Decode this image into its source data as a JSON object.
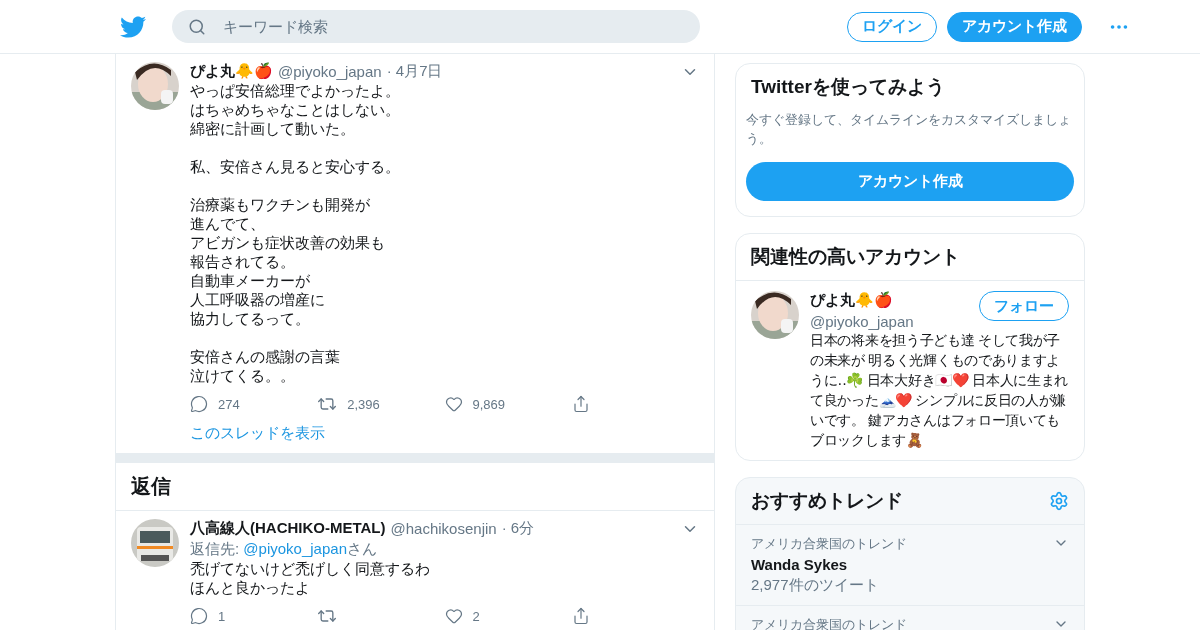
{
  "header": {
    "search": {
      "placeholder": "キーワード検索"
    },
    "login": "ログイン",
    "signup": "アカウント作成"
  },
  "tweet": {
    "name": "ぴよ丸🐥🍎",
    "handle": "@piyoko_japan",
    "time": "· 4月7日",
    "body": [
      [
        "やっぱ安倍総理でよかったよ。",
        "はちゃめちゃなことはしない。",
        "綿密に計画して動いた。"
      ],
      [
        "私、安倍さん見ると安心する。"
      ],
      [
        "治療薬もワクチンも開発が",
        "進んでて、",
        "アビガンも症状改善の効果も",
        "報告されてる。",
        "自動車メーカーが",
        "人工呼吸器の増産に",
        "協力してるって。"
      ],
      [
        "安倍さんの感謝の言葉",
        "泣けてくる。。"
      ]
    ],
    "replies": "274",
    "retweets": "2,396",
    "likes": "9,869",
    "thread_link": "このスレッドを表示"
  },
  "replies_heading": "返信",
  "reply": {
    "name": "八高線人(HACHIKO-METAL)",
    "handle": "@hachikosenjin",
    "time": "· 6分",
    "reply_to": {
      "prefix": "返信先: ",
      "mention": "@piyoko_japan",
      "suffix": "さん"
    },
    "body": [
      [
        "禿げてないけど禿げしく同意するわ",
        "ほんと良かったよ"
      ]
    ],
    "replies": "1",
    "likes": "2"
  },
  "signup_card": {
    "title": "Twitterを使ってみよう",
    "text": "今すぐ登録して、タイムラインをカスタマイズしましょう。",
    "button": "アカウント作成"
  },
  "related_card": {
    "title": "関連性の高いアカウント",
    "account": {
      "name": "ぴよ丸🐥🍎",
      "handle": "@piyoko_japan",
      "follow": "フォロー",
      "bio": "日本の将来を担う子ども達 そして我が子の未来が 明るく光輝くものでありますように‥☘️ 日本大好き🇯🇵❤️ 日本人に生まれて良かった🗻❤️ シンプルに反日の人が嫌いです。 鍵アカさんはフォロー頂いてもブロックします🧸"
    }
  },
  "trends_card": {
    "title": "おすすめトレンド",
    "items": [
      {
        "context": "アメリカ合衆国のトレンド",
        "name": "Wanda Sykes",
        "count": "2,977件のツイート"
      },
      {
        "context": "アメリカ合衆国のトレンド"
      }
    ]
  }
}
